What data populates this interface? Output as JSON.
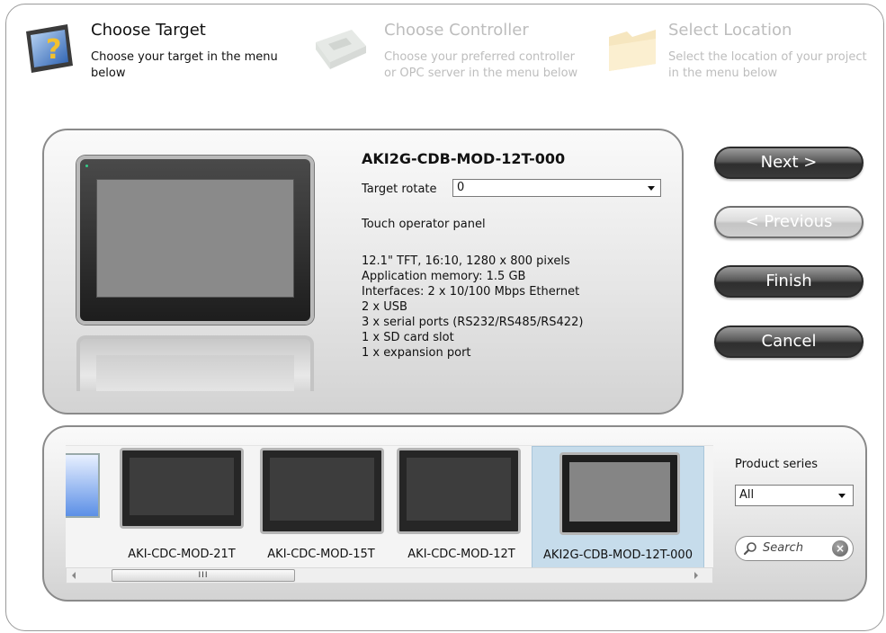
{
  "steps": [
    {
      "title": "Choose Target",
      "desc_line1": "Choose your target in the menu",
      "desc_line2": "below",
      "icon": "target-question-icon",
      "active": true
    },
    {
      "title": "Choose Controller",
      "desc_line1": "Choose your preferred controller",
      "desc_line2": "or OPC server in the menu below",
      "icon": "controller-icon",
      "active": false
    },
    {
      "title": "Select Location",
      "desc_line1": "Select the location of your project",
      "desc_line2": "in the menu below",
      "icon": "folder-icon",
      "active": false
    }
  ],
  "target": {
    "model": "AKI2G-CDB-MOD-12T-000",
    "rotate_label": "Target rotate",
    "rotate_value": "0",
    "type": "Touch operator panel",
    "specs": [
      "12.1\" TFT, 16:10, 1280 x 800 pixels",
      "Application memory: 1.5 GB",
      "Interfaces: 2 x 10/100 Mbps Ethernet",
      "2 x USB",
      "3 x serial ports (RS232/RS485/RS422)",
      "1 x SD card slot",
      "1 x expansion port"
    ]
  },
  "buttons": {
    "next": "Next >",
    "previous": "< Previous",
    "finish": "Finish",
    "cancel": "Cancel"
  },
  "gallery": {
    "items": [
      {
        "name": "AKI-CDC-MOD-21T",
        "selected": false
      },
      {
        "name": "AKI-CDC-MOD-15T",
        "selected": false
      },
      {
        "name": "AKI-CDC-MOD-12T",
        "selected": false
      },
      {
        "name": "AKI2G-CDB-MOD-12T-000",
        "selected": true
      }
    ],
    "series_label": "Product series",
    "series_value": "All",
    "search_placeholder": "Search",
    "scroll_grip": "III"
  },
  "colors": {
    "selected_tile": "#c6dceb",
    "inactive_text": "#bdbdbd"
  }
}
